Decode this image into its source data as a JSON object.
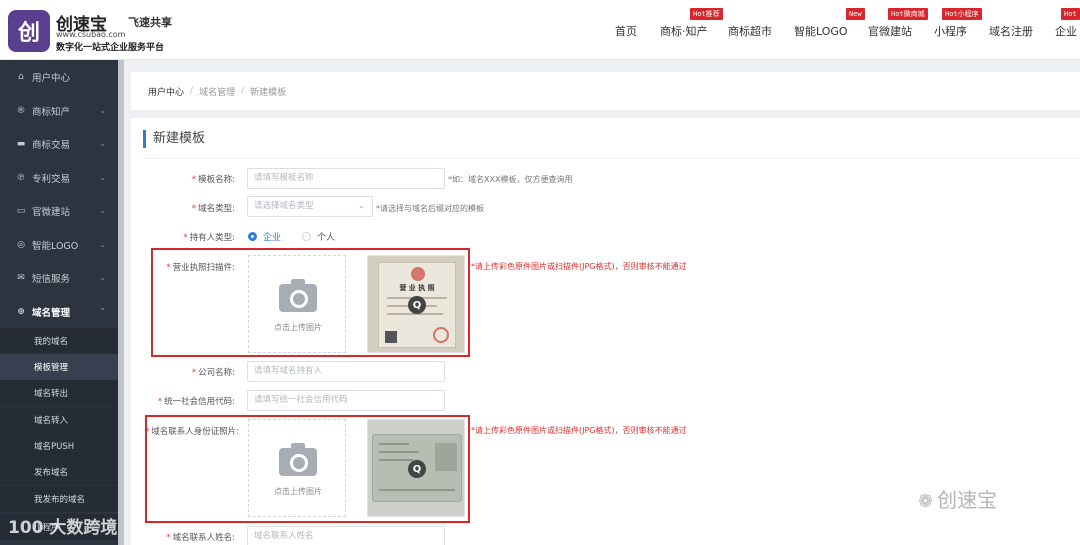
{
  "header": {
    "logo_glyph": "创",
    "brand_name": "创速宝",
    "brand_mark": "飞速共享",
    "site_url": "www.csubao.com",
    "slogan": "数字化一站式企业服务平台",
    "nav": [
      {
        "label": "首页",
        "badge": ""
      },
      {
        "label": "商标·知产",
        "badge": "Hot推荐"
      },
      {
        "label": "商标超市",
        "badge": ""
      },
      {
        "label": "智能LOGO",
        "badge": "New"
      },
      {
        "label": "官微建站",
        "badge": "Hot微商城"
      },
      {
        "label": "小程序",
        "badge": "Hot小程序"
      },
      {
        "label": "域名注册",
        "badge": ""
      },
      {
        "label": "企业",
        "badge": "Hot"
      }
    ]
  },
  "sidebar": {
    "items": [
      {
        "label": "用户中心",
        "icon": "home-icon",
        "glyph": "⌂"
      },
      {
        "label": "商标知产",
        "icon": "trademark-icon",
        "glyph": "®"
      },
      {
        "label": "商标交易",
        "icon": "cart-icon",
        "glyph": "▬"
      },
      {
        "label": "专利交易",
        "icon": "patent-icon",
        "glyph": "℗"
      },
      {
        "label": "官微建站",
        "icon": "monitor-icon",
        "glyph": "▭"
      },
      {
        "label": "智能LOGO",
        "icon": "target-icon",
        "glyph": "◎"
      },
      {
        "label": "短信服务",
        "icon": "mail-icon",
        "glyph": "✉"
      },
      {
        "label": "域名管理",
        "icon": "globe-icon",
        "glyph": "⊕"
      }
    ],
    "subitems": [
      {
        "label": "我的域名"
      },
      {
        "label": "模板管理"
      },
      {
        "label": "域名转出"
      },
      {
        "label": "域名转入"
      },
      {
        "label": "域名PUSH"
      },
      {
        "label": "发布域名"
      },
      {
        "label": "我发布的域名"
      },
      {
        "label": "小程序"
      }
    ]
  },
  "breadcrumb": {
    "items": [
      "用户中心",
      "域名管理",
      "新建模板"
    ],
    "separator": "/"
  },
  "form": {
    "title": "新建模板",
    "template_name": {
      "label": "模板名称:",
      "placeholder": "请填写模板名称",
      "hint": "*如：域名XXX模板，仅方便查询用"
    },
    "domain_type": {
      "label": "域名类型:",
      "placeholder": "请选择域名类型",
      "hint": "*请选择与域名后缀对应的模板"
    },
    "holder_type": {
      "label": "持有人类型:",
      "options": [
        "企业",
        "个人"
      ],
      "selected": "企业"
    },
    "license": {
      "label": "营业执照扫描件:",
      "upload_text": "点击上传图片",
      "thumb_text": "营 业 执 照",
      "hint": "*请上传彩色原件图片或扫描件(JPG格式)，否则审核不能通过"
    },
    "company_name": {
      "label": "公司名称:",
      "placeholder": "请填写域名持有人"
    },
    "credit_code": {
      "label": "统一社会信用代码:",
      "placeholder": "请填写统一社会信用代码"
    },
    "id_card": {
      "label": "域名联系人身份证照片:",
      "upload_text": "点击上传图片",
      "hint": "*请上传彩色原件图片或扫描件(JPG格式)，否则审核不能通过"
    },
    "contact_name": {
      "label": "域名联系人姓名:",
      "placeholder": "域名联系人姓名"
    }
  },
  "watermarks": {
    "right": "创速宝",
    "left": "100 大数跨境"
  },
  "colors": {
    "accent": "#2d7dd2",
    "sidebar_bg": "#2c3440",
    "badge_red": "#d9262c",
    "required_red": "#e23c3c",
    "highlight_box": "#d62828"
  }
}
